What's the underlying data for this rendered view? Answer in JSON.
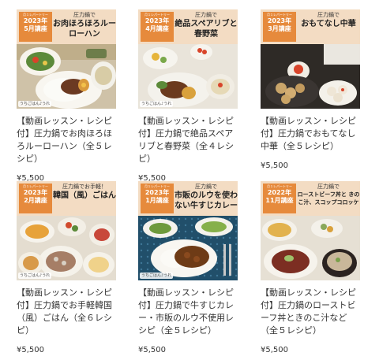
{
  "cards": [
    {
      "badge_tiny": "月１レパートリー",
      "year": "2023年",
      "month": "5月講座",
      "kicker": "圧力鍋で",
      "heading": "お肉ほろほろルーローハン",
      "logo": "うちごはん♪うれ",
      "title": "【動画レッスン・レシピ付】圧力鍋でお肉ほろほろルーローハン（全５レシピ）",
      "price": "¥5,500"
    },
    {
      "badge_tiny": "月１レパートリー",
      "year": "2023年",
      "month": "4月講座",
      "kicker": "圧力鍋で",
      "heading": "絶品スペアリブと春野菜",
      "logo": "うちごはん♪うれ",
      "title": "【動画レッスン・レシピ付】圧力鍋で絶品スペアリブと春野菜（全４レシピ）",
      "price": "¥5,500"
    },
    {
      "badge_tiny": "月１レパートリー",
      "year": "2023年",
      "month": "3月講座",
      "kicker": "圧力鍋で",
      "heading": "おもてなし中華",
      "logo": "",
      "title": "【動画レッスン・レシピ付】圧力鍋でおもてなし中華（全５レシピ）",
      "price": "¥5,500"
    },
    {
      "badge_tiny": "月１レパートリー",
      "year": "2023年",
      "month": "2月講座",
      "kicker": "圧力鍋でお手軽！",
      "heading": "韓国（風）ごはん",
      "logo": "うちごはん♪うれ",
      "title": "【動画レッスン・レシピ付】圧力鍋でお手軽韓国（風）ごはん（全６レシピ）",
      "price": "¥5,500"
    },
    {
      "badge_tiny": "月１レパートリー",
      "year": "2023年",
      "month": "1月講座",
      "kicker": "圧力鍋で",
      "heading": "市販のルウを使わない牛すじカレー",
      "logo": "うちごはん♪うれ",
      "title": "【動画レッスン・レシピ付】圧力鍋で牛すじカレー・市販のルウ不使用レシピ（全５レシピ）",
      "price": "¥5,500"
    },
    {
      "badge_tiny": "月１レパートリー",
      "year": "2022年",
      "month": "11月講座",
      "kicker": "圧力鍋で",
      "heading": "ローストビーフ丼と きのこ汁、スコップコロッケ",
      "logo": "",
      "title": "【動画レッスン・レシピ付】圧力鍋のローストビーフ丼ときのこ汁など（全５レシピ）",
      "price": "¥5,500"
    }
  ]
}
